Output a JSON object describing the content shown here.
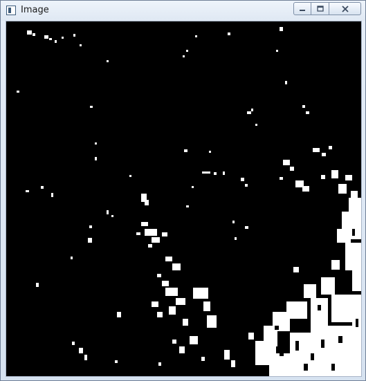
{
  "window": {
    "title": "Image",
    "icons": {
      "app": "app-window-icon",
      "minimize": "minimize-icon",
      "maximize": "maximize-icon",
      "close": "close-icon"
    }
  },
  "canvas": {
    "description_type": "binary-threshold-image",
    "foreground_color": "#ffffff",
    "background_color": "#000000"
  }
}
